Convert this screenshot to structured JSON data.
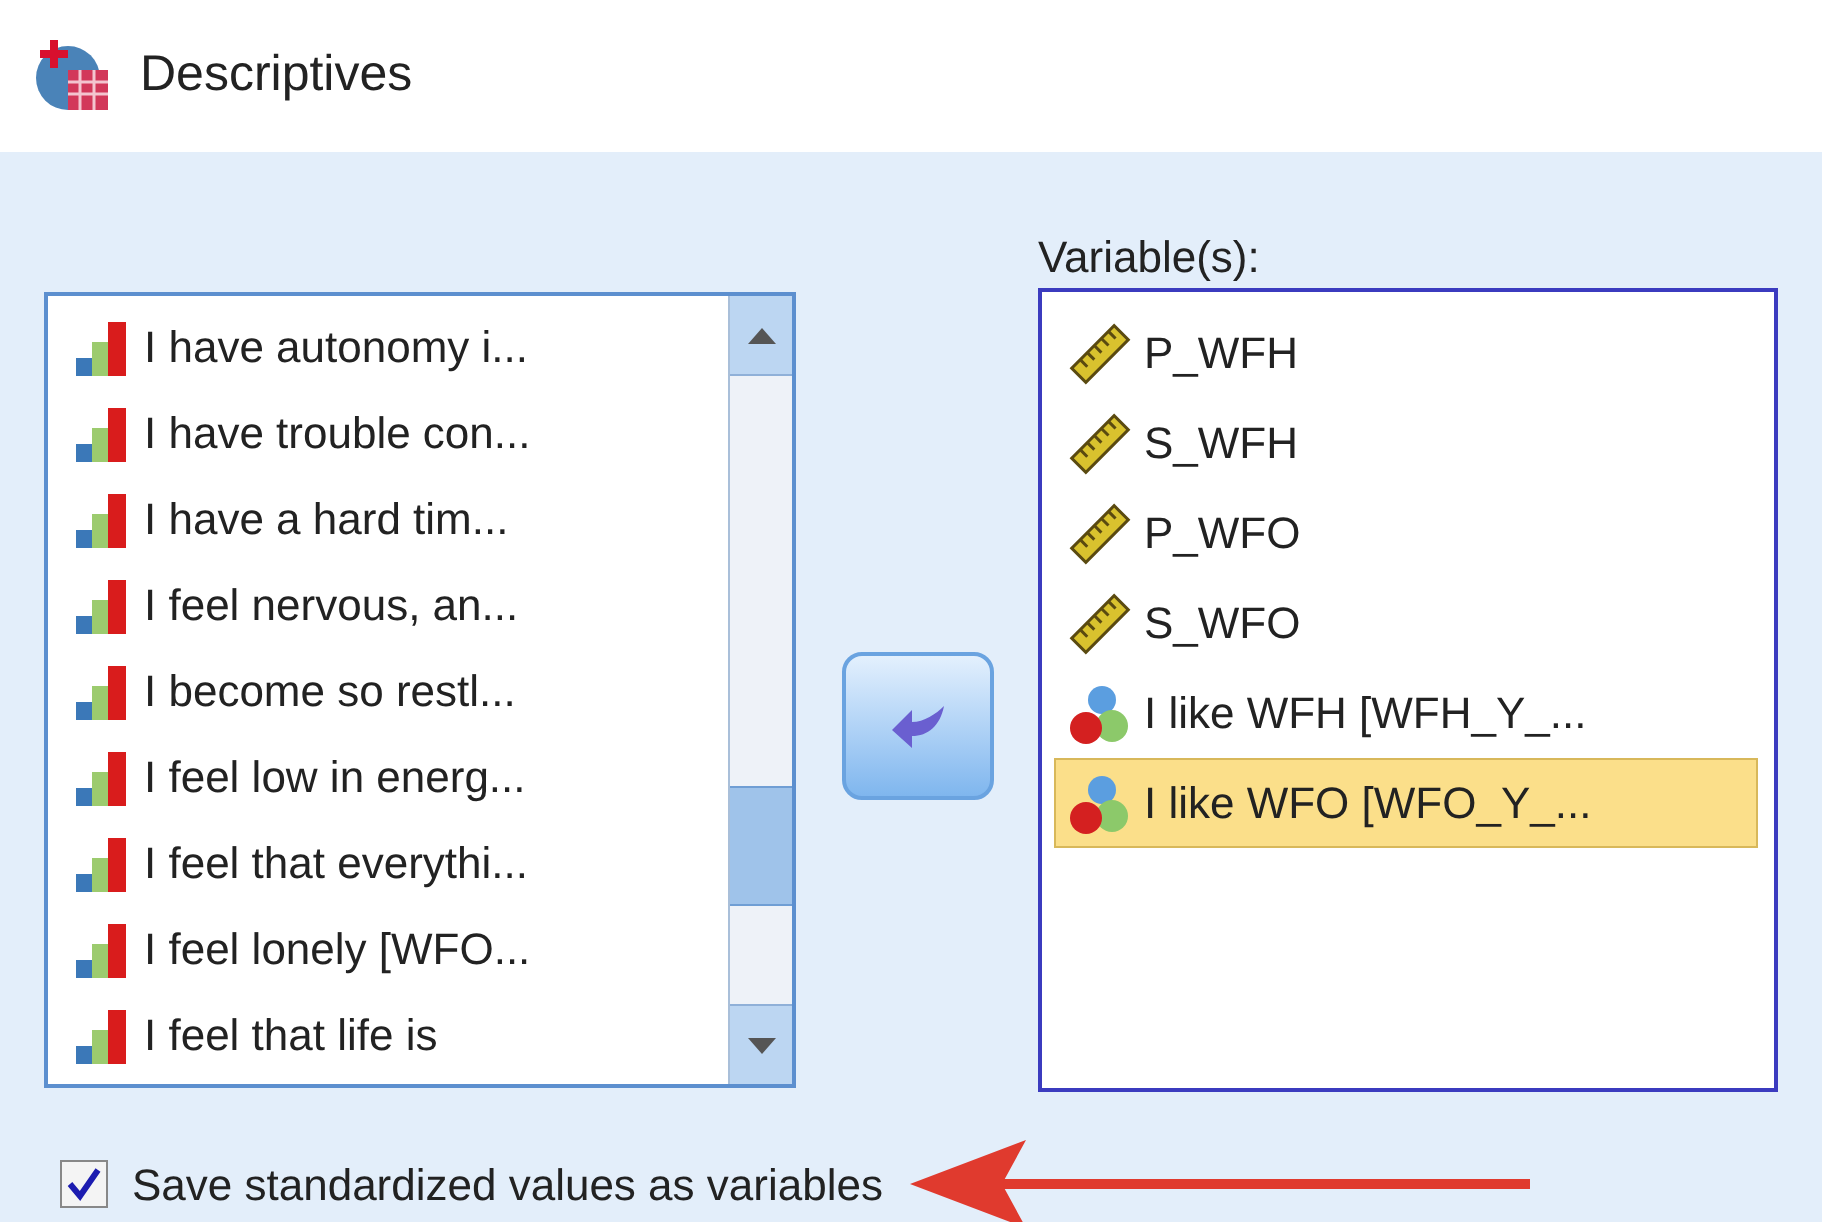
{
  "window": {
    "title": "Descriptives"
  },
  "source_list": {
    "items": [
      {
        "label": "I have autonomy i...",
        "kind": "ordinal"
      },
      {
        "label": "I have trouble con...",
        "kind": "ordinal"
      },
      {
        "label": "I have a hard tim...",
        "kind": "ordinal"
      },
      {
        "label": "I feel nervous, an...",
        "kind": "ordinal"
      },
      {
        "label": "I become so restl...",
        "kind": "ordinal"
      },
      {
        "label": "I feel low in energ...",
        "kind": "ordinal"
      },
      {
        "label": "I feel that everythi...",
        "kind": "ordinal"
      },
      {
        "label": "I feel lonely [WFO...",
        "kind": "ordinal"
      },
      {
        "label": "I feel that life is",
        "kind": "ordinal"
      }
    ]
  },
  "variables": {
    "label": "Variable(s):",
    "items": [
      {
        "label": "P_WFH",
        "kind": "scale",
        "selected": false
      },
      {
        "label": "S_WFH",
        "kind": "scale",
        "selected": false
      },
      {
        "label": "P_WFO",
        "kind": "scale",
        "selected": false
      },
      {
        "label": "S_WFO",
        "kind": "scale",
        "selected": false
      },
      {
        "label": "I like WFH [WFH_Y_...",
        "kind": "nominal",
        "selected": false
      },
      {
        "label": "I like WFO [WFO_Y_...",
        "kind": "nominal",
        "selected": true
      }
    ]
  },
  "save_standardized": {
    "label": "Save standardized values as variables",
    "checked": true
  }
}
